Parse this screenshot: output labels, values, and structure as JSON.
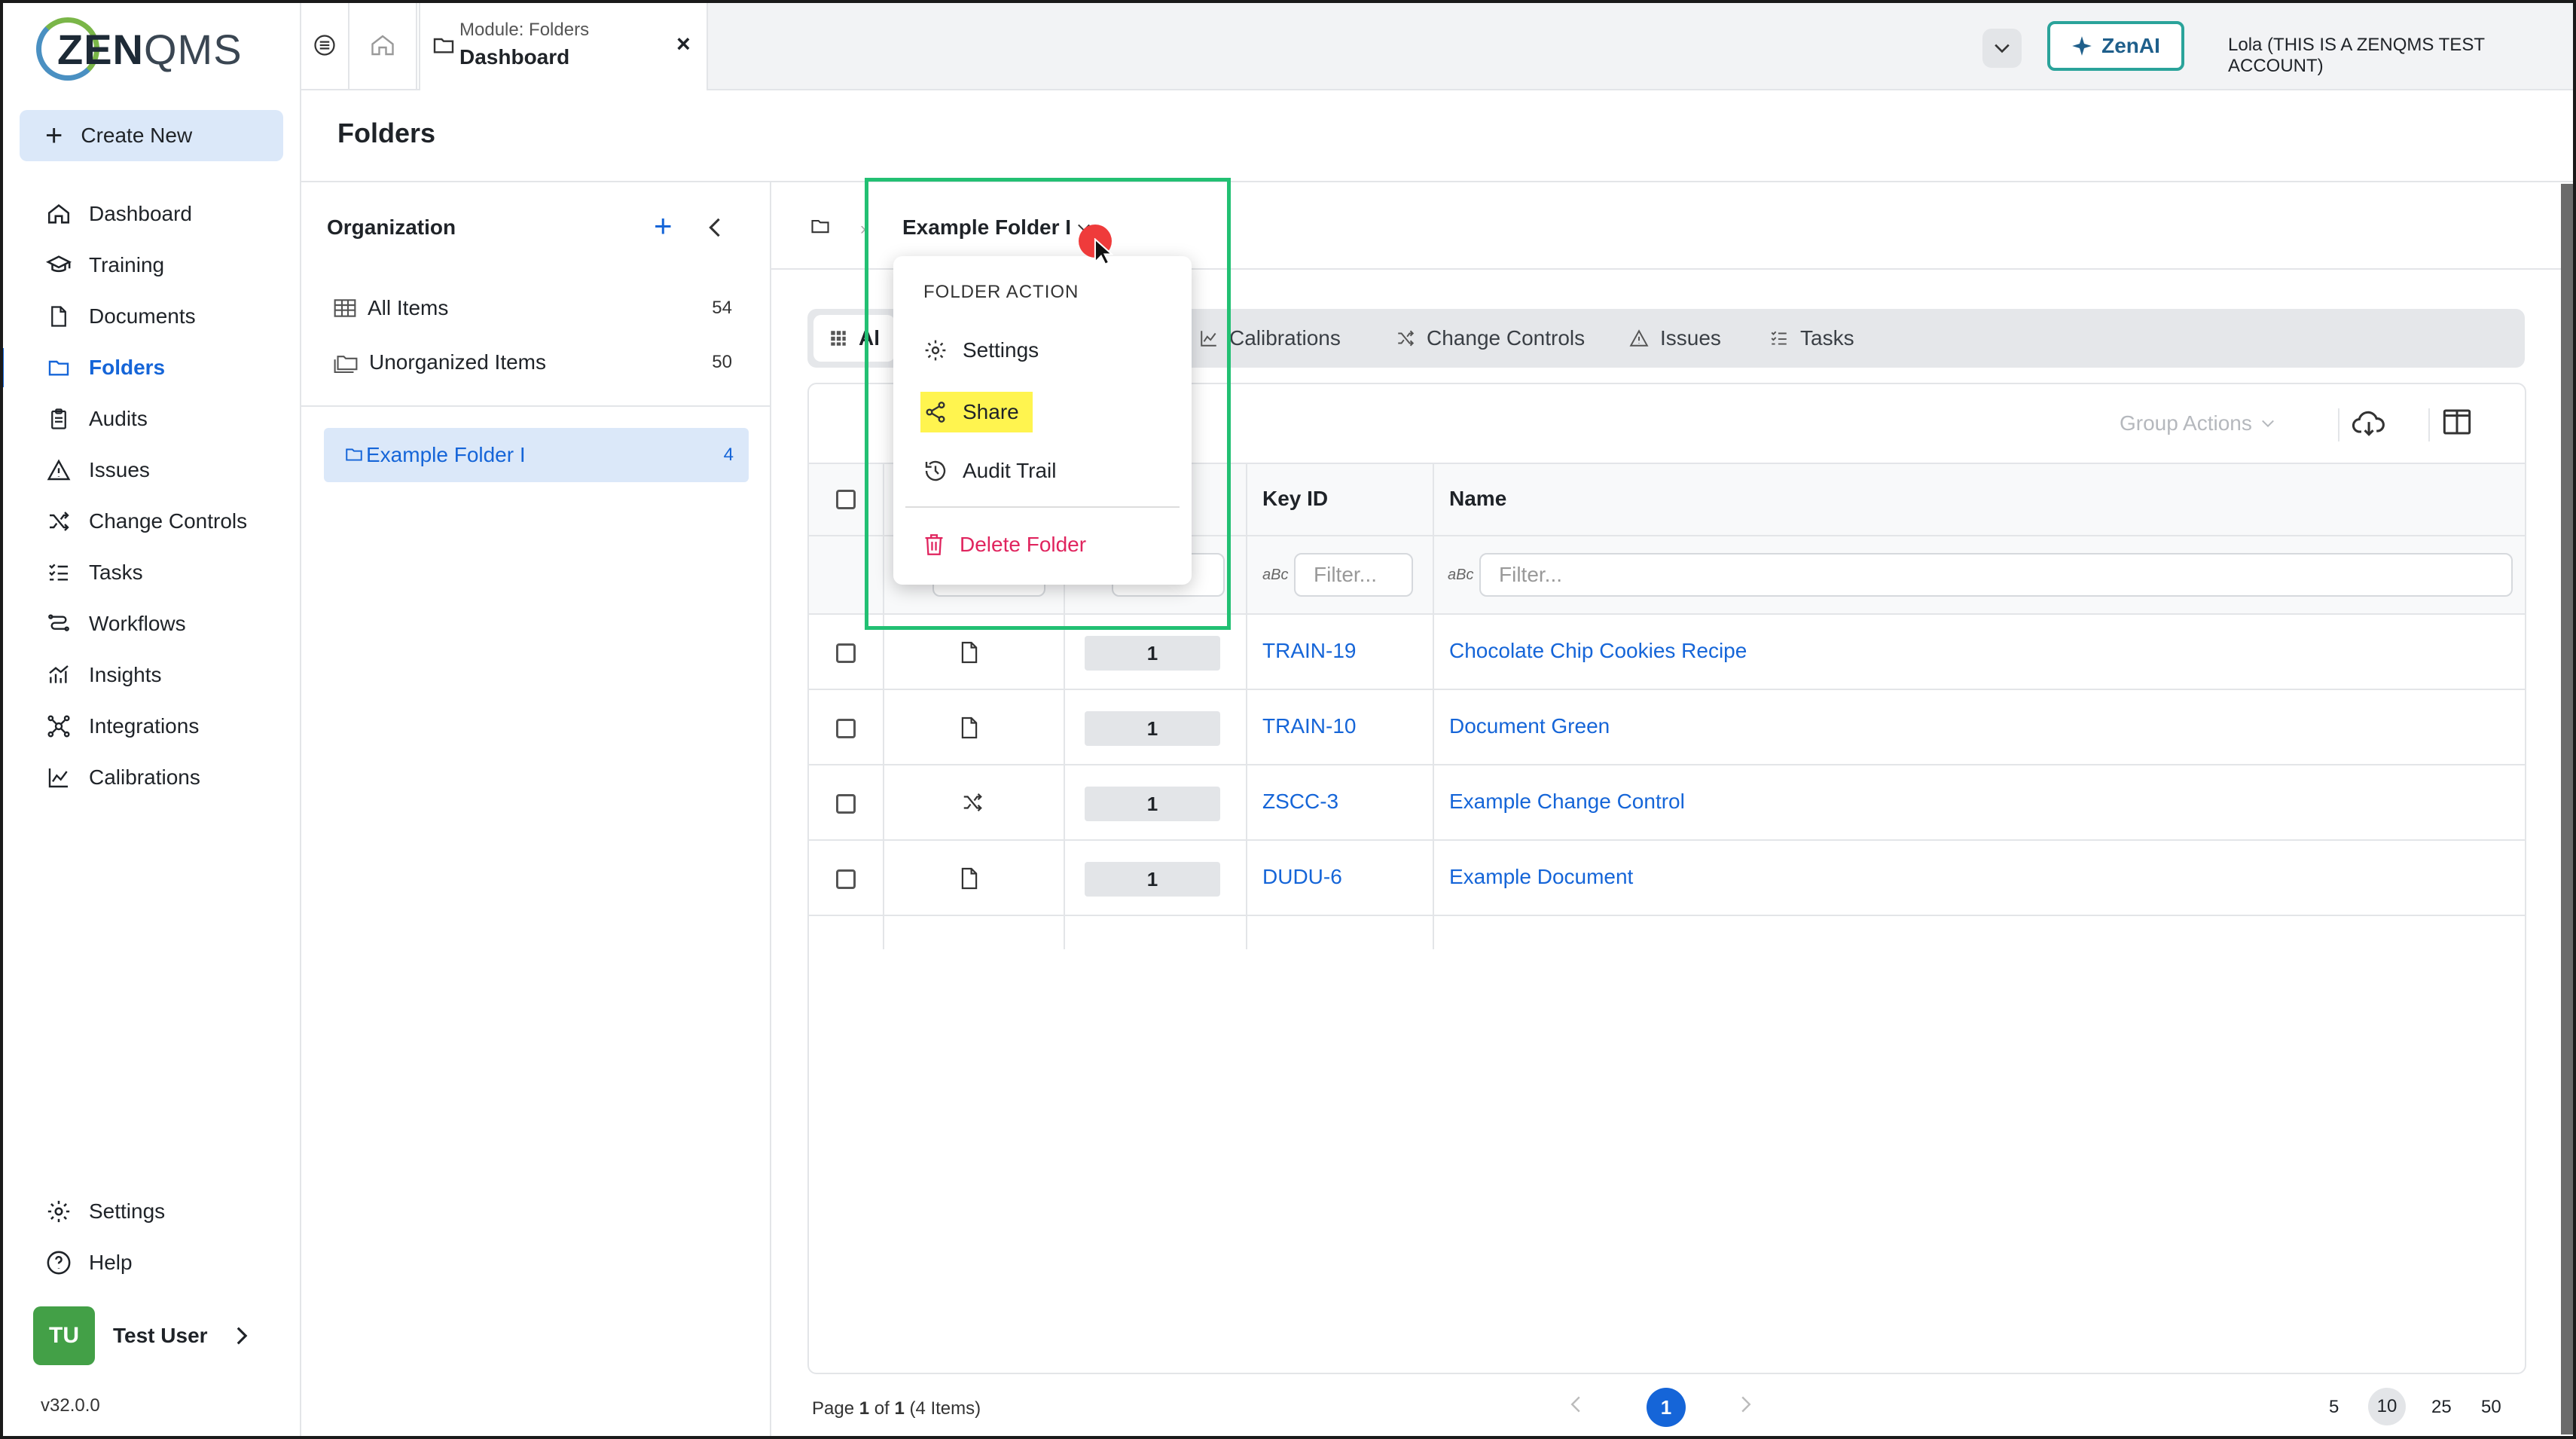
{
  "logo": {
    "bold": "ZEN",
    "thin": "QMS"
  },
  "sidebar": {
    "create_label": "Create New",
    "items": [
      {
        "label": "Dashboard",
        "icon": "home-icon"
      },
      {
        "label": "Training",
        "icon": "graduation-cap-icon"
      },
      {
        "label": "Documents",
        "icon": "document-icon"
      },
      {
        "label": "Folders",
        "icon": "folder-icon",
        "active": true
      },
      {
        "label": "Audits",
        "icon": "clipboard-icon"
      },
      {
        "label": "Issues",
        "icon": "warning-icon"
      },
      {
        "label": "Change Controls",
        "icon": "shuffle-icon"
      },
      {
        "label": "Tasks",
        "icon": "task-list-icon"
      },
      {
        "label": "Workflows",
        "icon": "workflow-icon"
      },
      {
        "label": "Insights",
        "icon": "insights-icon"
      },
      {
        "label": "Integrations",
        "icon": "integrations-icon"
      },
      {
        "label": "Calibrations",
        "icon": "line-chart-icon"
      }
    ],
    "bottom": [
      {
        "label": "Settings",
        "icon": "gear-icon"
      },
      {
        "label": "Help",
        "icon": "help-icon"
      }
    ],
    "user": {
      "initials": "TU",
      "name": "Test User"
    },
    "version": "v32.0.0"
  },
  "topbar": {
    "tab_subtitle": "Module: Folders",
    "tab_title": "Dashboard",
    "tab_close": "×",
    "zenai_label": "ZenAI",
    "account": "Lola (THIS IS A ZENQMS TEST ACCOUNT)"
  },
  "page": {
    "title": "Folders"
  },
  "org": {
    "title": "Organization",
    "plus": "+",
    "all_items": {
      "label": "All Items",
      "count": "54"
    },
    "unorganized": {
      "label": "Unorganized Items",
      "count": "50"
    },
    "folder": {
      "label": "Example Folder I",
      "count": "4"
    }
  },
  "breadcrumb": {
    "current": "Example Folder I"
  },
  "tabs": [
    {
      "label": "Al",
      "icon": "grid-icon"
    },
    {
      "label": "Calibrations",
      "icon": "line-chart-icon"
    },
    {
      "label": "Change Controls",
      "icon": "shuffle-icon"
    },
    {
      "label": "Issues",
      "icon": "warning-icon"
    },
    {
      "label": "Tasks",
      "icon": "task-list-icon"
    }
  ],
  "toolbar": {
    "group_actions": "Group Actions"
  },
  "table": {
    "headers": {
      "key_id": "Key ID",
      "name": "Name"
    },
    "filter_placeholder": "Filter...",
    "abc": "aBc",
    "rows": [
      {
        "type": "document-icon",
        "version": "1",
        "key": "TRAIN-19",
        "name": "Chocolate Chip Cookies Recipe"
      },
      {
        "type": "document-icon",
        "version": "1",
        "key": "TRAIN-10",
        "name": "Document Green"
      },
      {
        "type": "shuffle-icon",
        "version": "1",
        "key": "ZSCC-3",
        "name": "Example Change Control"
      },
      {
        "type": "document-icon",
        "version": "1",
        "key": "DUDU-6",
        "name": "Example Document"
      }
    ]
  },
  "pagination": {
    "text_prefix": "Page ",
    "page": "1",
    "text_mid": " of ",
    "total": "1",
    "text_suffix": " (4 Items)",
    "current": "1",
    "sizes": [
      "5",
      "10",
      "25",
      "50"
    ],
    "selected_size": "10"
  },
  "menu": {
    "header": "FOLDER ACTION",
    "settings": "Settings",
    "share": "Share",
    "audit_trail": "Audit Trail",
    "delete": "Delete Folder"
  },
  "colors": {
    "accent": "#1565d8",
    "highlight": "#fff44f",
    "annotation": "#22c073",
    "danger": "#e0245e",
    "cursor": "#ef3b3b"
  }
}
